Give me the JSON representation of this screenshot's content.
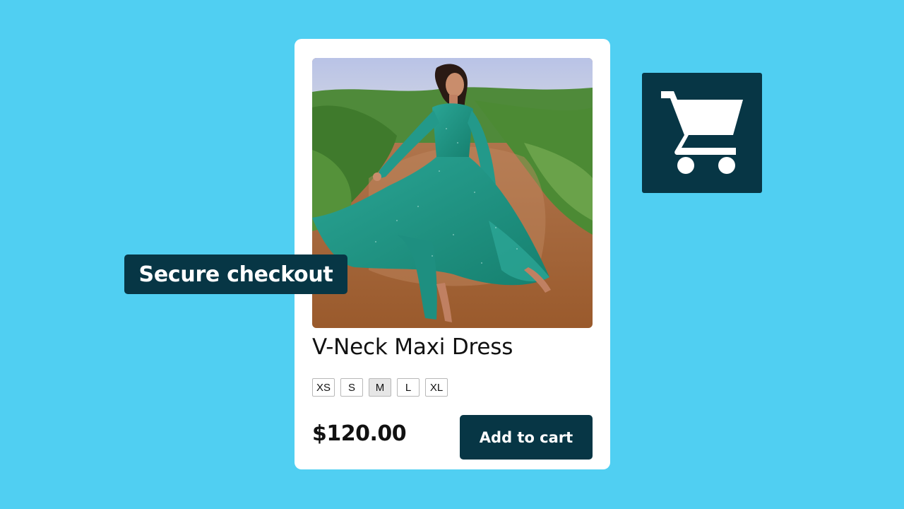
{
  "product": {
    "title": "V-Neck Maxi Dress",
    "price": "$120.00",
    "image_alt": "Woman in a teal maxi dress on a dirt path",
    "sizes": [
      {
        "label": "XS",
        "selected": false
      },
      {
        "label": "S",
        "selected": false
      },
      {
        "label": "M",
        "selected": true
      },
      {
        "label": "L",
        "selected": false
      },
      {
        "label": "XL",
        "selected": false
      }
    ],
    "add_to_cart_label": "Add to cart"
  },
  "badge": {
    "label": "Secure checkout"
  },
  "cart_tile": {
    "icon": "shopping-cart-icon"
  },
  "colors": {
    "background": "#50CFF2",
    "accent": "#073645",
    "card": "#FFFFFF",
    "dress": "#1E9A8A"
  }
}
